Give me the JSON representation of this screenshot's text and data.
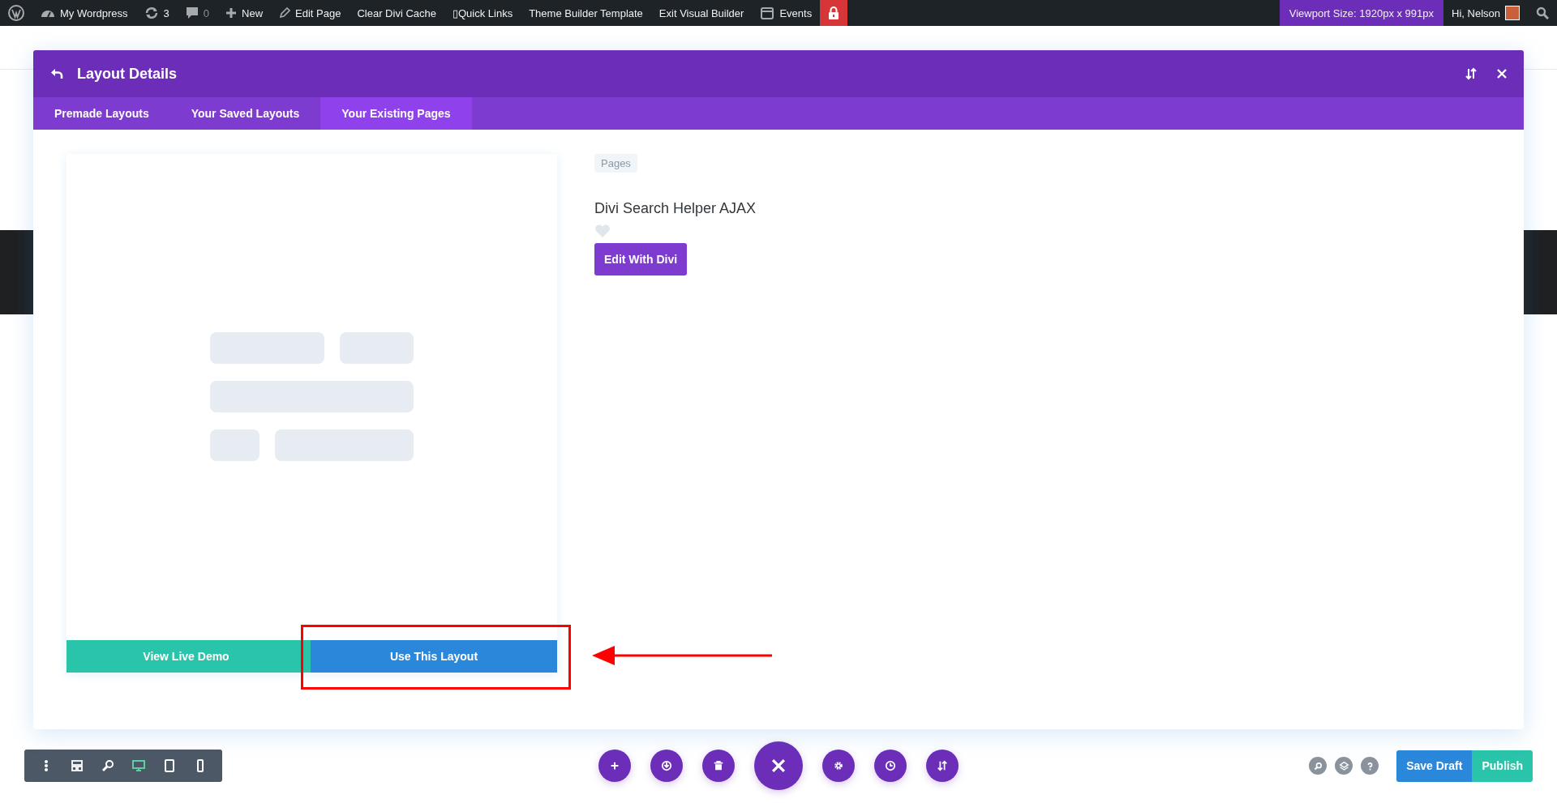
{
  "admin_bar": {
    "items": [
      {
        "kind": "wordpress"
      },
      {
        "kind": "dashboard",
        "label": "My Wordpress"
      },
      {
        "kind": "updates",
        "label": "3"
      },
      {
        "kind": "comments",
        "label": "0"
      },
      {
        "kind": "new",
        "label": "New"
      },
      {
        "kind": "edit",
        "label": "Edit Page"
      },
      {
        "kind": "text",
        "label": "Clear Divi Cache"
      },
      {
        "kind": "text",
        "label": "▯Quick Links"
      },
      {
        "kind": "text",
        "label": "Theme Builder Template"
      },
      {
        "kind": "text",
        "label": "Exit Visual Builder"
      },
      {
        "kind": "events",
        "label": "Events"
      },
      {
        "kind": "lock"
      }
    ],
    "viewport": "Viewport Size: 1920px x 991px",
    "greeting": "Hi, Nelson"
  },
  "modal": {
    "title": "Layout Details",
    "tabs": [
      {
        "label": "Premade Layouts",
        "selected": false
      },
      {
        "label": "Your Saved Layouts",
        "selected": false
      },
      {
        "label": "Your Existing Pages",
        "selected": true
      }
    ],
    "preview_buttons": [
      {
        "kind": "demo",
        "label": "View Live Demo"
      },
      {
        "kind": "use",
        "label": "Use This Layout"
      }
    ],
    "category": "Pages",
    "layout_name": "Divi Search Helper AJAX",
    "favorited": false,
    "edit_button": "Edit With Divi"
  },
  "toolbar": {
    "modes": [
      {
        "kind": "menu",
        "selected": false
      },
      {
        "kind": "wireframe",
        "selected": false
      },
      {
        "kind": "zoom",
        "selected": false
      },
      {
        "kind": "desktop",
        "selected": true
      },
      {
        "kind": "tablet",
        "selected": false
      },
      {
        "kind": "phone",
        "selected": false
      }
    ],
    "actions": [
      {
        "kind": "add"
      },
      {
        "kind": "portability"
      },
      {
        "kind": "clear"
      },
      {
        "kind": "close"
      },
      {
        "kind": "settings"
      },
      {
        "kind": "history"
      },
      {
        "kind": "sort"
      }
    ],
    "helpers": [
      {
        "kind": "search"
      },
      {
        "kind": "layers"
      },
      {
        "kind": "help"
      }
    ],
    "save_button": "Save Draft",
    "publish_button": "Publish"
  }
}
